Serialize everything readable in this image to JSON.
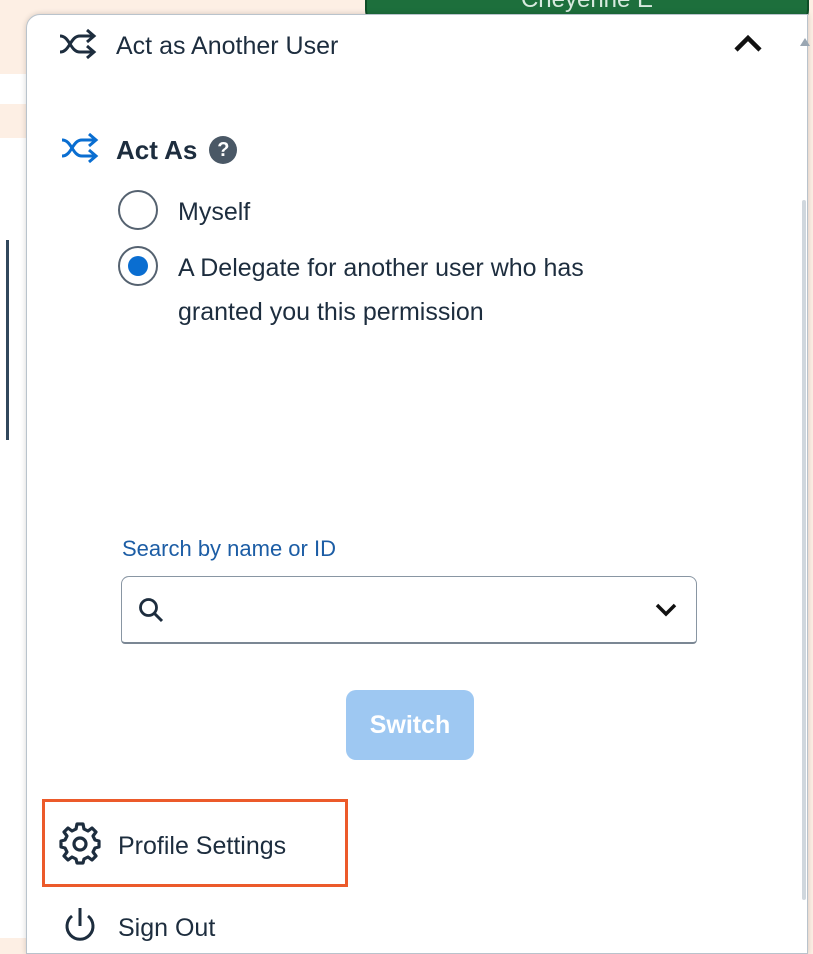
{
  "user_pill": {
    "name": "Cheyenne E"
  },
  "section": {
    "title": "Act as Another User"
  },
  "act_as": {
    "title": "Act As",
    "help_glyph": "?",
    "options": [
      {
        "label": "Myself",
        "checked": false
      },
      {
        "label": "A Delegate for another user who has granted you this permission",
        "checked": true
      }
    ]
  },
  "search": {
    "label": "Search by name or ID",
    "value": "",
    "placeholder": ""
  },
  "switch_button": {
    "label": "Switch"
  },
  "menu": {
    "profile_settings": "Profile Settings",
    "sign_out": "Sign Out"
  },
  "colors": {
    "accent": "#0a6ed1",
    "highlight": "#ec5a2a",
    "switch_disabled": "#9ec8f2"
  }
}
